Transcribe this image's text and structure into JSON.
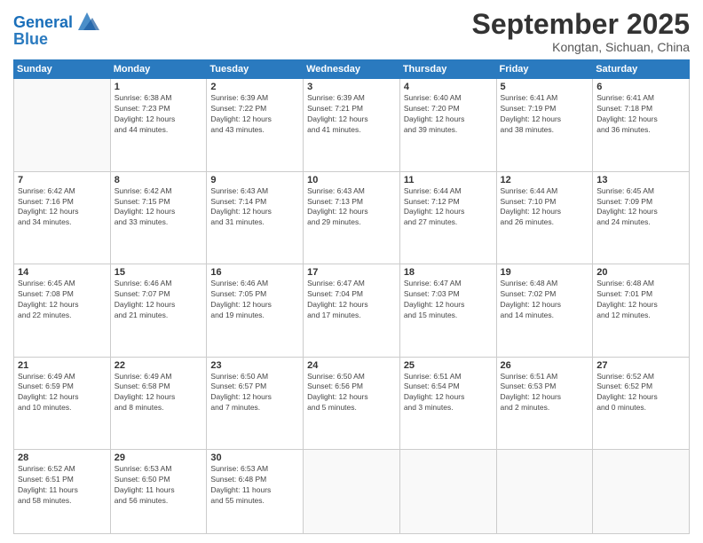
{
  "header": {
    "logo_line1": "General",
    "logo_line2": "Blue",
    "month": "September 2025",
    "location": "Kongtan, Sichuan, China"
  },
  "weekdays": [
    "Sunday",
    "Monday",
    "Tuesday",
    "Wednesday",
    "Thursday",
    "Friday",
    "Saturday"
  ],
  "weeks": [
    [
      {
        "day": "",
        "info": ""
      },
      {
        "day": "1",
        "info": "Sunrise: 6:38 AM\nSunset: 7:23 PM\nDaylight: 12 hours\nand 44 minutes."
      },
      {
        "day": "2",
        "info": "Sunrise: 6:39 AM\nSunset: 7:22 PM\nDaylight: 12 hours\nand 43 minutes."
      },
      {
        "day": "3",
        "info": "Sunrise: 6:39 AM\nSunset: 7:21 PM\nDaylight: 12 hours\nand 41 minutes."
      },
      {
        "day": "4",
        "info": "Sunrise: 6:40 AM\nSunset: 7:20 PM\nDaylight: 12 hours\nand 39 minutes."
      },
      {
        "day": "5",
        "info": "Sunrise: 6:41 AM\nSunset: 7:19 PM\nDaylight: 12 hours\nand 38 minutes."
      },
      {
        "day": "6",
        "info": "Sunrise: 6:41 AM\nSunset: 7:18 PM\nDaylight: 12 hours\nand 36 minutes."
      }
    ],
    [
      {
        "day": "7",
        "info": "Sunrise: 6:42 AM\nSunset: 7:16 PM\nDaylight: 12 hours\nand 34 minutes."
      },
      {
        "day": "8",
        "info": "Sunrise: 6:42 AM\nSunset: 7:15 PM\nDaylight: 12 hours\nand 33 minutes."
      },
      {
        "day": "9",
        "info": "Sunrise: 6:43 AM\nSunset: 7:14 PM\nDaylight: 12 hours\nand 31 minutes."
      },
      {
        "day": "10",
        "info": "Sunrise: 6:43 AM\nSunset: 7:13 PM\nDaylight: 12 hours\nand 29 minutes."
      },
      {
        "day": "11",
        "info": "Sunrise: 6:44 AM\nSunset: 7:12 PM\nDaylight: 12 hours\nand 27 minutes."
      },
      {
        "day": "12",
        "info": "Sunrise: 6:44 AM\nSunset: 7:10 PM\nDaylight: 12 hours\nand 26 minutes."
      },
      {
        "day": "13",
        "info": "Sunrise: 6:45 AM\nSunset: 7:09 PM\nDaylight: 12 hours\nand 24 minutes."
      }
    ],
    [
      {
        "day": "14",
        "info": "Sunrise: 6:45 AM\nSunset: 7:08 PM\nDaylight: 12 hours\nand 22 minutes."
      },
      {
        "day": "15",
        "info": "Sunrise: 6:46 AM\nSunset: 7:07 PM\nDaylight: 12 hours\nand 21 minutes."
      },
      {
        "day": "16",
        "info": "Sunrise: 6:46 AM\nSunset: 7:05 PM\nDaylight: 12 hours\nand 19 minutes."
      },
      {
        "day": "17",
        "info": "Sunrise: 6:47 AM\nSunset: 7:04 PM\nDaylight: 12 hours\nand 17 minutes."
      },
      {
        "day": "18",
        "info": "Sunrise: 6:47 AM\nSunset: 7:03 PM\nDaylight: 12 hours\nand 15 minutes."
      },
      {
        "day": "19",
        "info": "Sunrise: 6:48 AM\nSunset: 7:02 PM\nDaylight: 12 hours\nand 14 minutes."
      },
      {
        "day": "20",
        "info": "Sunrise: 6:48 AM\nSunset: 7:01 PM\nDaylight: 12 hours\nand 12 minutes."
      }
    ],
    [
      {
        "day": "21",
        "info": "Sunrise: 6:49 AM\nSunset: 6:59 PM\nDaylight: 12 hours\nand 10 minutes."
      },
      {
        "day": "22",
        "info": "Sunrise: 6:49 AM\nSunset: 6:58 PM\nDaylight: 12 hours\nand 8 minutes."
      },
      {
        "day": "23",
        "info": "Sunrise: 6:50 AM\nSunset: 6:57 PM\nDaylight: 12 hours\nand 7 minutes."
      },
      {
        "day": "24",
        "info": "Sunrise: 6:50 AM\nSunset: 6:56 PM\nDaylight: 12 hours\nand 5 minutes."
      },
      {
        "day": "25",
        "info": "Sunrise: 6:51 AM\nSunset: 6:54 PM\nDaylight: 12 hours\nand 3 minutes."
      },
      {
        "day": "26",
        "info": "Sunrise: 6:51 AM\nSunset: 6:53 PM\nDaylight: 12 hours\nand 2 minutes."
      },
      {
        "day": "27",
        "info": "Sunrise: 6:52 AM\nSunset: 6:52 PM\nDaylight: 12 hours\nand 0 minutes."
      }
    ],
    [
      {
        "day": "28",
        "info": "Sunrise: 6:52 AM\nSunset: 6:51 PM\nDaylight: 11 hours\nand 58 minutes."
      },
      {
        "day": "29",
        "info": "Sunrise: 6:53 AM\nSunset: 6:50 PM\nDaylight: 11 hours\nand 56 minutes."
      },
      {
        "day": "30",
        "info": "Sunrise: 6:53 AM\nSunset: 6:48 PM\nDaylight: 11 hours\nand 55 minutes."
      },
      {
        "day": "",
        "info": ""
      },
      {
        "day": "",
        "info": ""
      },
      {
        "day": "",
        "info": ""
      },
      {
        "day": "",
        "info": ""
      }
    ]
  ]
}
